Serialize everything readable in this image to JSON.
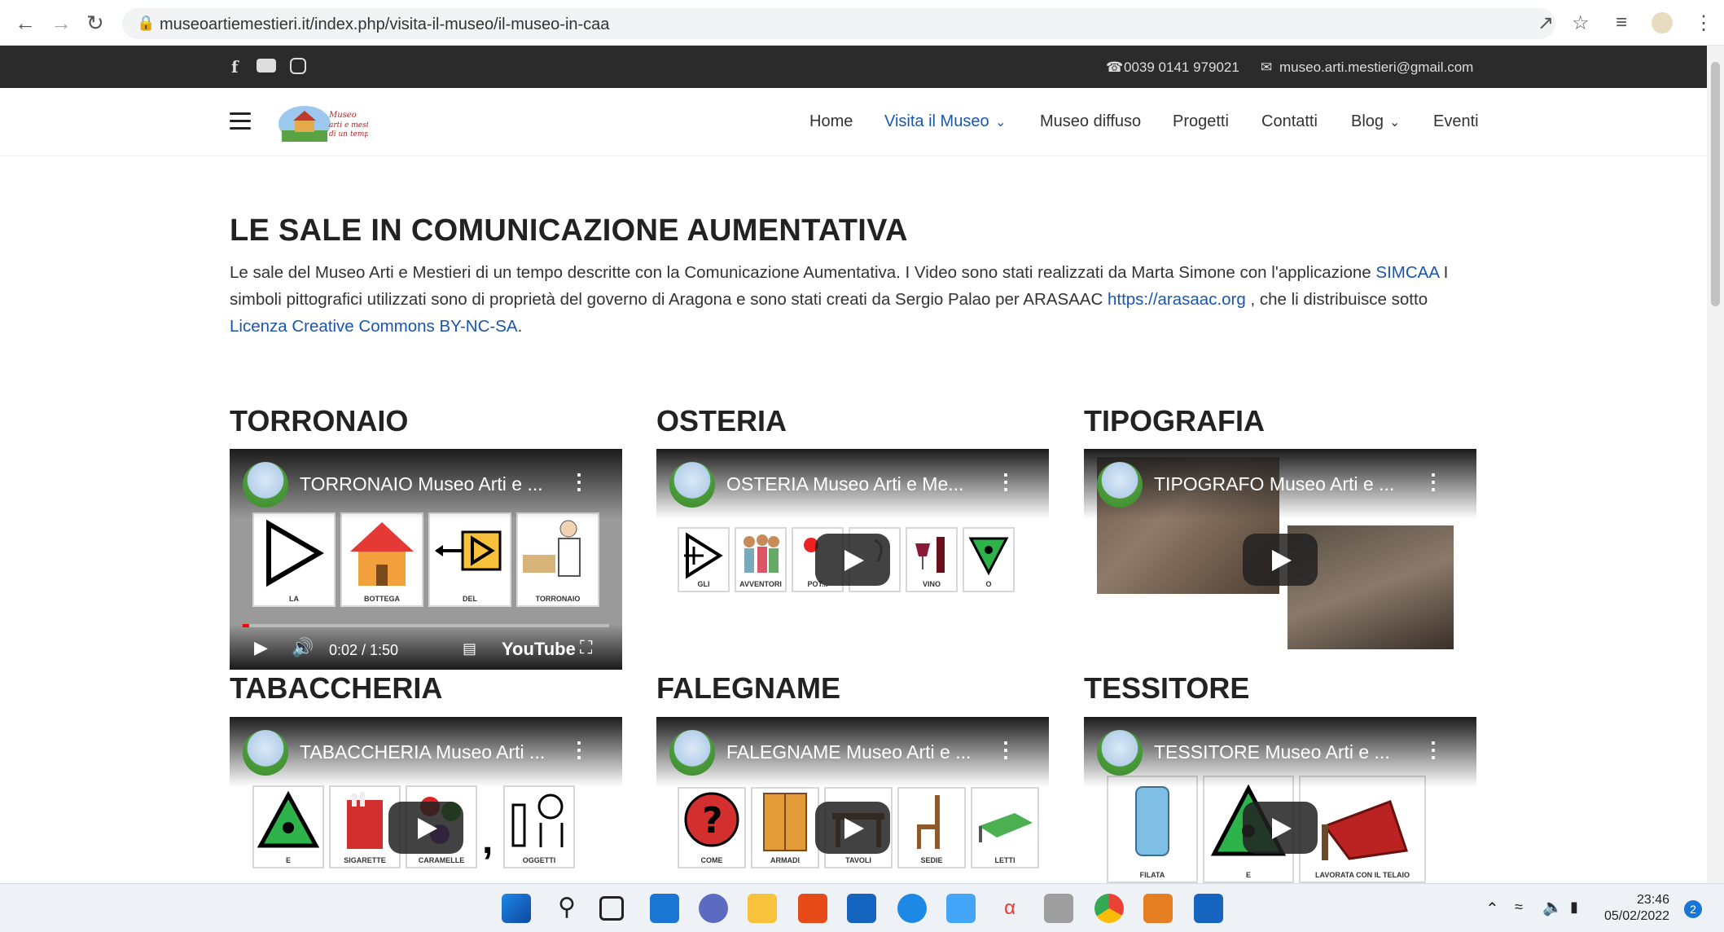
{
  "browser": {
    "url": "museoartiemestieri.it/index.php/visita-il-museo/il-museo-in-caa"
  },
  "topbar": {
    "phone": "0039 0141 979021",
    "email": "museo.arti.mestieri@gmail.com"
  },
  "nav": {
    "items": [
      {
        "label": "Home"
      },
      {
        "label": "Visita il Museo"
      },
      {
        "label": "Museo diffuso"
      },
      {
        "label": "Progetti"
      },
      {
        "label": "Contatti"
      },
      {
        "label": "Blog"
      },
      {
        "label": "Eventi"
      }
    ],
    "active_color": "#1a56b0"
  },
  "page": {
    "title": "LE SALE IN COMUNICAZIONE AUMENTATIVA",
    "intro_1": "Le sale del Museo Arti e Mestieri di un tempo descritte con la Comunicazione Aumentativa. I Video sono stati realizzati da Marta Simone con l'applicazione ",
    "intro_link_simcaa": "SIMCAA",
    "intro_2": " I simboli pittografici utilizzati sono di proprietà del governo di Aragona e sono stati creati da Sergio Palao per ARASAAC ",
    "intro_link_arasaac": "https://arasaac.org",
    "intro_3": " , che li distribuisce sotto ",
    "intro_link_license": "Licenza Creative Commons BY-NC-SA",
    "intro_4": "."
  },
  "sections": [
    {
      "heading": "TORRONAIO",
      "video_title": "TORRONAIO Museo Arti e ...",
      "pictos": [
        "LA",
        "BOTTEGA",
        "DEL",
        "TORRONAIO"
      ],
      "time": "0:02 / 1:50",
      "yt": "YouTube"
    },
    {
      "heading": "OSTERIA",
      "video_title": "OSTERIA Museo Arti e Me...",
      "pictos": [
        "GLI",
        "AVVENTORI",
        "POT...",
        "",
        "VINO",
        "O"
      ]
    },
    {
      "heading": "TIPOGRAFIA",
      "video_title": "TIPOGRAFO Museo Arti e ..."
    },
    {
      "heading": "TABACCHERIA",
      "video_title": "TABACCHERIA Museo Arti ...",
      "pictos": [
        "E",
        "SIGARETTE",
        "CARAMELLE",
        "OGGETTI"
      ]
    },
    {
      "heading": "FALEGNAME",
      "video_title": "FALEGNAME Museo Arti e ...",
      "pictos": [
        "COME",
        "ARMADI",
        "TAVOLI",
        "SEDIE",
        "LETTI"
      ]
    },
    {
      "heading": "TESSITORE",
      "video_title": "TESSITORE Museo Arti e ...",
      "pictos": [
        "FILATA",
        "E",
        "LAVORATA CON IL TELAIO"
      ]
    }
  ],
  "taskbar": {
    "time": "23:46",
    "date": "05/02/2022",
    "badge": "2"
  }
}
